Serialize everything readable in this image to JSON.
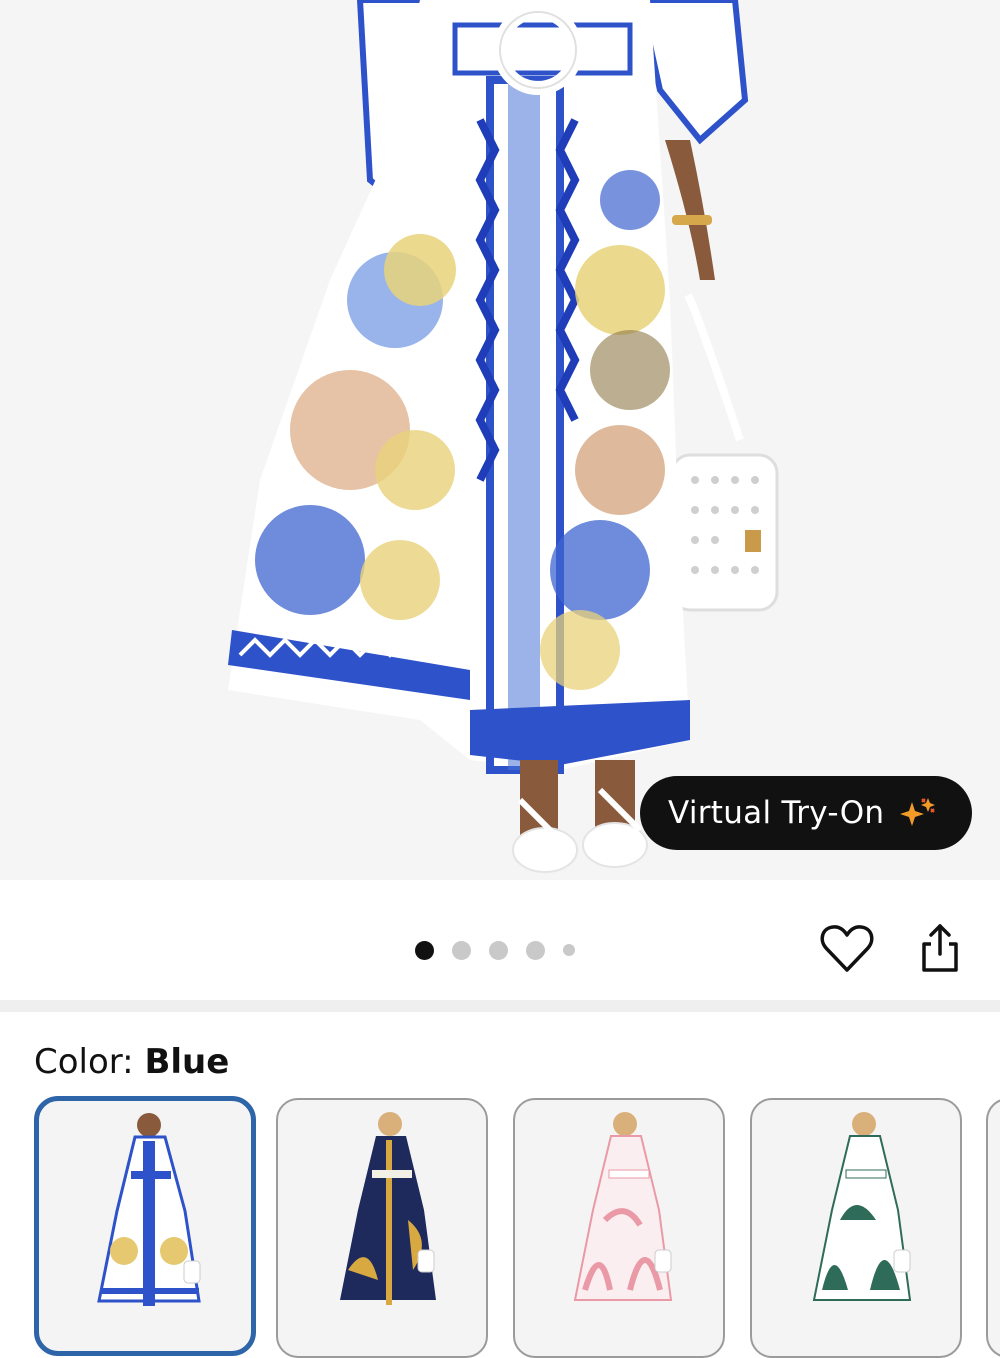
{
  "product_image": {
    "description_icon": "dress-photo",
    "try_on_label": "Virtual Try-On",
    "try_on_icon": "sparkle-icon"
  },
  "gallery": {
    "dot_count": 5,
    "active_index": 0
  },
  "actions": {
    "wishlist_icon": "heart-icon",
    "share_icon": "share-icon"
  },
  "color": {
    "label": "Color: ",
    "value": "Blue"
  },
  "swatches": [
    {
      "name": "Blue",
      "fabric": "#ffffff",
      "print": "#2e52c9",
      "accent": "#e6c870",
      "selected": true
    },
    {
      "name": "Navy",
      "fabric": "#1f2a5c",
      "print": "#d9a941",
      "accent": "#f3f0e6",
      "selected": false
    },
    {
      "name": "Pink",
      "fabric": "#fbeef0",
      "print": "#e99aa6",
      "accent": "#ffffff",
      "selected": false
    },
    {
      "name": "Green",
      "fabric": "#ffffff",
      "print": "#2e6b58",
      "accent": "#ffffff",
      "selected": false
    }
  ],
  "colors": {
    "accent_selected": "#2e64a8",
    "try_on_bg": "#111111",
    "sparkle_orange": "#f29b28"
  }
}
